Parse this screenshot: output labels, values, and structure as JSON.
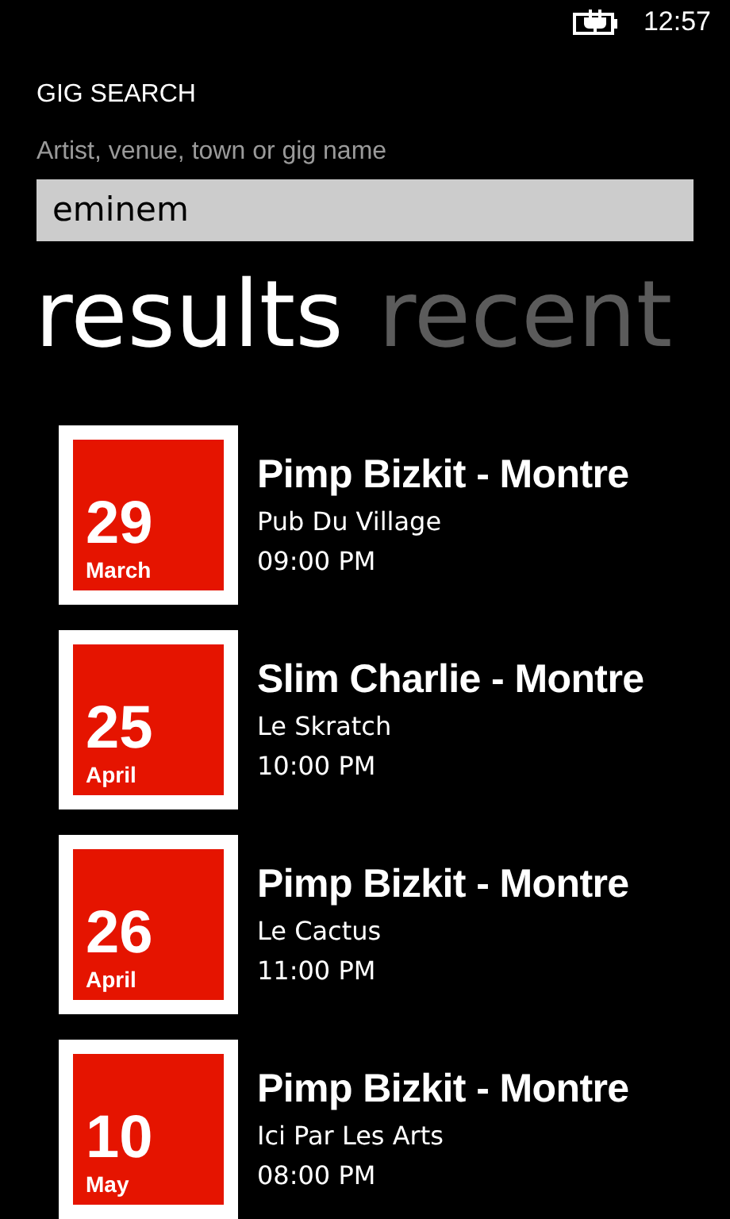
{
  "status_bar": {
    "time": "12:57"
  },
  "page_title": "GIG SEARCH",
  "search": {
    "label": "Artist, venue, town or gig name",
    "value": "eminem"
  },
  "pivots": [
    {
      "label": "results",
      "selected": true
    },
    {
      "label": "recent",
      "selected": false
    }
  ],
  "results": [
    {
      "day": "29",
      "month": "March",
      "title": "Pimp Bizkit - Montre",
      "venue": "Pub Du Village",
      "time": "09:00 PM"
    },
    {
      "day": "25",
      "month": "April",
      "title": "Slim Charlie - Montre",
      "venue": "Le Skratch",
      "time": "10:00 PM"
    },
    {
      "day": "26",
      "month": "April",
      "title": "Pimp Bizkit - Montre",
      "venue": "Le Cactus",
      "time": "11:00 PM"
    },
    {
      "day": "10",
      "month": "May",
      "title": "Pimp Bizkit - Montre",
      "venue": "Ici Par Les Arts",
      "time": "08:00 PM"
    }
  ]
}
